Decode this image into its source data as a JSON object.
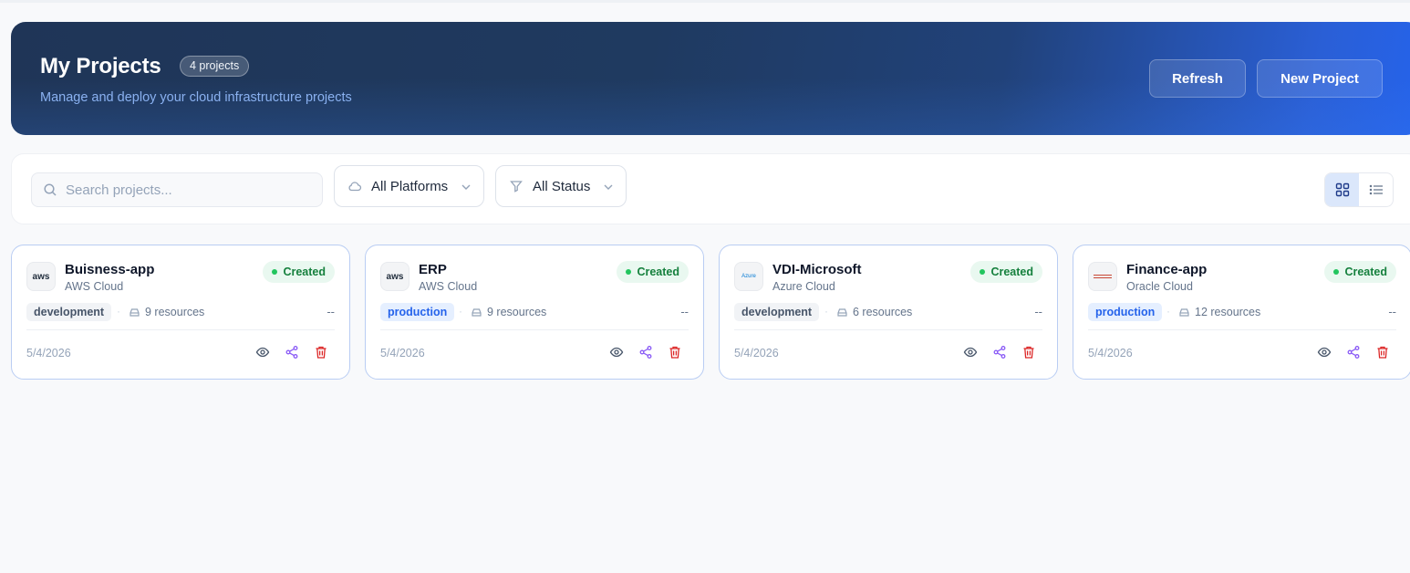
{
  "header": {
    "title": "My Projects",
    "count_badge": "4 projects",
    "subtitle": "Manage and deploy your cloud infrastructure projects",
    "refresh_label": "Refresh",
    "new_project_label": "New Project"
  },
  "filters": {
    "search_placeholder": "Search projects...",
    "platform_selected": "All Platforms",
    "status_selected": "All Status",
    "view_mode": "grid"
  },
  "projects": [
    {
      "name": "Buisness-app",
      "cloud": "AWS Cloud",
      "logo": "aws",
      "status": "Created",
      "environment": "development",
      "resources": "9 resources",
      "extra": "--",
      "date": "5/4/2026"
    },
    {
      "name": "ERP",
      "cloud": "AWS Cloud",
      "logo": "aws",
      "status": "Created",
      "environment": "production",
      "resources": "9 resources",
      "extra": "--",
      "date": "5/4/2026"
    },
    {
      "name": "VDI-Microsoft",
      "cloud": "Azure Cloud",
      "logo": "Azure",
      "status": "Created",
      "environment": "development",
      "resources": "6 resources",
      "extra": "--",
      "date": "5/4/2026"
    },
    {
      "name": "Finance-app",
      "cloud": "Oracle Cloud",
      "logo": "oracle",
      "status": "Created",
      "environment": "production",
      "resources": "12 resources",
      "extra": "--",
      "date": "5/4/2026"
    }
  ],
  "colors": {
    "status_green": "#15803d",
    "production_blue": "#2563eb",
    "delete_red": "#dc2626",
    "share_purple": "#8b5cf6"
  }
}
